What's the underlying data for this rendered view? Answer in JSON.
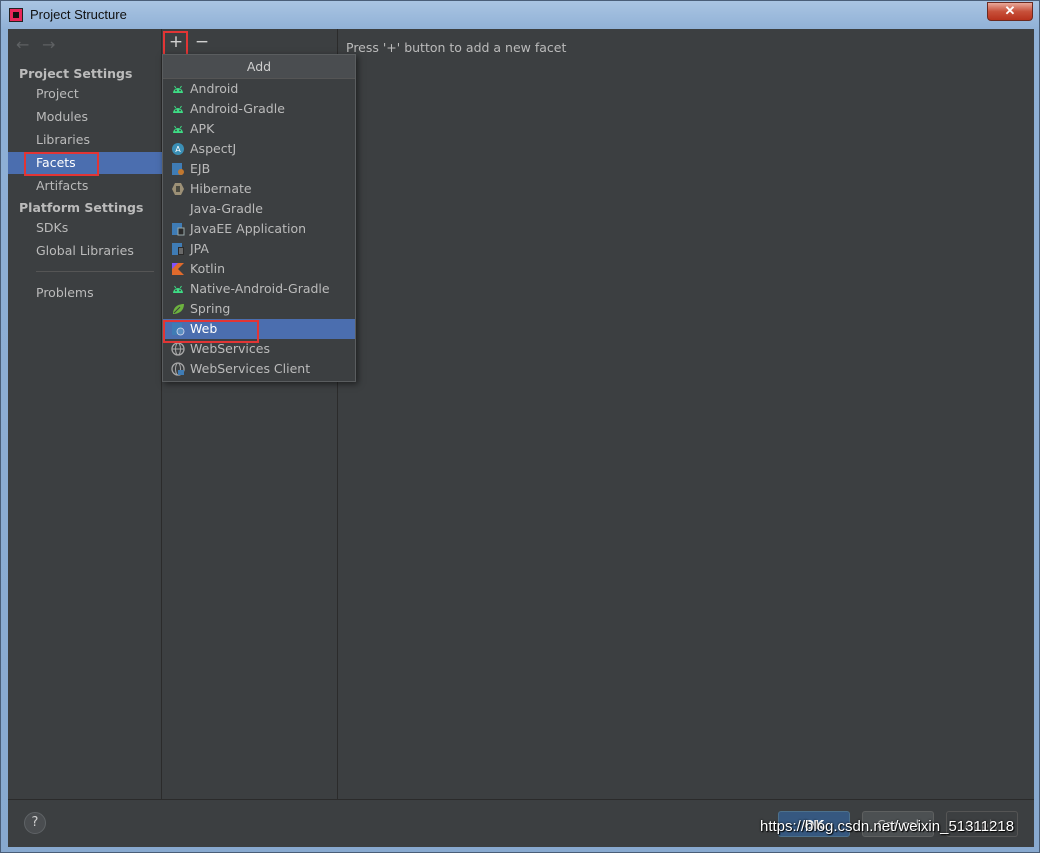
{
  "window": {
    "title": "Project Structure",
    "close_label": "✕"
  },
  "nav": {
    "back": "←",
    "forward": "→"
  },
  "sidebar": {
    "project_settings_heading": "Project Settings",
    "project_items": [
      {
        "label": "Project"
      },
      {
        "label": "Modules"
      },
      {
        "label": "Libraries"
      },
      {
        "label": "Facets",
        "selected": true
      },
      {
        "label": "Artifacts"
      }
    ],
    "platform_settings_heading": "Platform Settings",
    "platform_items": [
      {
        "label": "SDKs"
      },
      {
        "label": "Global Libraries"
      }
    ],
    "problems_label": "Problems"
  },
  "toolbar": {
    "add": "+",
    "remove": "−"
  },
  "popup": {
    "title": "Add",
    "items": [
      {
        "label": "Android",
        "icon": "android-icon"
      },
      {
        "label": "Android-Gradle",
        "icon": "android-icon"
      },
      {
        "label": "APK",
        "icon": "android-icon"
      },
      {
        "label": "AspectJ",
        "icon": "aspectj-icon"
      },
      {
        "label": "EJB",
        "icon": "ejb-icon"
      },
      {
        "label": "Hibernate",
        "icon": "hibernate-icon"
      },
      {
        "label": "Java-Gradle",
        "icon": ""
      },
      {
        "label": "JavaEE Application",
        "icon": "javaee-icon"
      },
      {
        "label": "JPA",
        "icon": "jpa-icon"
      },
      {
        "label": "Kotlin",
        "icon": "kotlin-icon"
      },
      {
        "label": "Native-Android-Gradle",
        "icon": "android-icon"
      },
      {
        "label": "Spring",
        "icon": "spring-icon"
      },
      {
        "label": "Web",
        "icon": "web-icon",
        "selected": true
      },
      {
        "label": "WebServices",
        "icon": "globe-icon"
      },
      {
        "label": "WebServices Client",
        "icon": "globe-client-icon"
      }
    ]
  },
  "content": {
    "hint": "Press '+' button to add a new facet"
  },
  "footer": {
    "help": "?",
    "ok": "OK",
    "cancel": "Cancel",
    "apply": "Apply",
    "watermark": "https://blog.csdn.net/weixin_51311218"
  },
  "colors": {
    "accent": "#4b6eaf",
    "highlight": "#e23535",
    "ok_button": "#365880",
    "background": "#3c3f41"
  }
}
